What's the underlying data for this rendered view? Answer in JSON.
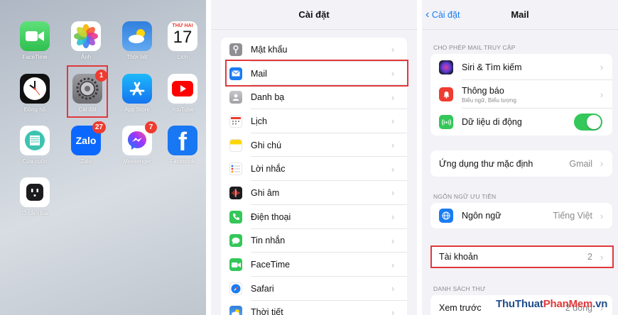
{
  "home": {
    "apps": [
      {
        "label": "FaceTime",
        "icon": "facetime-icon",
        "color": "#4cd964",
        "badge": ""
      },
      {
        "label": "Ảnh",
        "icon": "photos-icon",
        "color": "#ffffff",
        "badge": ""
      },
      {
        "label": "Thời tiết",
        "icon": "weather-icon",
        "color": "#3a8ee6",
        "badge": ""
      },
      {
        "label": "Lịch",
        "icon": "calendar-icon",
        "color": "#ffffff",
        "badge": "",
        "weekday": "THỨ HAI",
        "day": "17"
      },
      {
        "label": "Đồng hồ",
        "icon": "clock-icon",
        "color": "#111111",
        "badge": ""
      },
      {
        "label": "Cài đặt",
        "icon": "settings-gear-icon",
        "color": "#8e8e93",
        "badge": "1"
      },
      {
        "label": "App Store",
        "icon": "app-store-icon",
        "color": "#1c8ef9",
        "badge": ""
      },
      {
        "label": "YouTube",
        "icon": "youtube-icon",
        "color": "#ffffff",
        "badge": ""
      },
      {
        "label": "Cửa cuốn",
        "icon": "shutter-door-icon",
        "color": "#ffffff",
        "badge": ""
      },
      {
        "label": "Zalo",
        "icon": "zalo-icon",
        "color": "#0a68ff",
        "badge": "27",
        "text": "Zalo"
      },
      {
        "label": "Messenger",
        "icon": "messenger-icon",
        "color": "#ffffff",
        "badge": "7"
      },
      {
        "label": "Facebook",
        "icon": "facebook-icon",
        "color": "#1877f2",
        "badge": "",
        "text": "f"
      },
      {
        "label": "Ổ cắm loa",
        "icon": "power-outlet-icon",
        "color": "#ffffff",
        "badge": ""
      }
    ]
  },
  "settings": {
    "title": "Cài đặt",
    "rows": [
      {
        "label": "Mật khẩu",
        "icon": "key-icon",
        "color": "#8e8e93"
      },
      {
        "label": "Mail",
        "icon": "mail-icon",
        "color": "#1a7cf2"
      },
      {
        "label": "Danh bạ",
        "icon": "contacts-icon",
        "color": "#b0b0b5"
      },
      {
        "label": "Lịch",
        "icon": "calendar-icon",
        "color": "#ffffff"
      },
      {
        "label": "Ghi chú",
        "icon": "notes-icon",
        "color": "#ffd60a"
      },
      {
        "label": "Lời nhắc",
        "icon": "reminders-icon",
        "color": "#ffffff"
      },
      {
        "label": "Ghi âm",
        "icon": "voice-memos-icon",
        "color": "#1c1c1e"
      },
      {
        "label": "Điện thoại",
        "icon": "phone-icon",
        "color": "#34c759"
      },
      {
        "label": "Tin nhắn",
        "icon": "messages-icon",
        "color": "#34c759"
      },
      {
        "label": "FaceTime",
        "icon": "facetime-icon",
        "color": "#34c759"
      },
      {
        "label": "Safari",
        "icon": "safari-icon",
        "color": "#1a7cf2"
      },
      {
        "label": "Thời tiết",
        "icon": "weather-icon",
        "color": "#3a8ee6"
      }
    ]
  },
  "mail": {
    "back_label": "Cài đặt",
    "title": "Mail",
    "section_access": "CHO PHÉP MAIL TRUY CẬP",
    "siri": {
      "label": "Siri & Tìm kiếm",
      "icon": "siri-icon",
      "color": "#2b2b4f"
    },
    "notifications": {
      "label": "Thông báo",
      "sub": "Biểu ngữ, Biểu tượng",
      "icon": "notifications-icon",
      "color": "#ef3b30"
    },
    "cellular": {
      "label": "Dữ liệu di động",
      "icon": "cellular-icon",
      "color": "#34c759",
      "on": true
    },
    "default_app": {
      "label": "Ứng dụng thư mặc định",
      "value": "Gmail"
    },
    "section_lang": "NGÔN NGỮ ƯU TIÊN",
    "language": {
      "label": "Ngôn ngữ",
      "value": "Tiếng Việt",
      "icon": "globe-icon",
      "color": "#1a7cf2"
    },
    "accounts": {
      "label": "Tài khoản",
      "value": "2"
    },
    "section_list": "DANH SÁCH THƯ",
    "preview": {
      "label": "Xem trước",
      "value": "2 dòng"
    }
  },
  "watermark": {
    "part1": "ThuThuat",
    "part2": "PhanMem",
    "part3": ".vn"
  },
  "chevron": "›",
  "accent_highlight": "#e0393b"
}
